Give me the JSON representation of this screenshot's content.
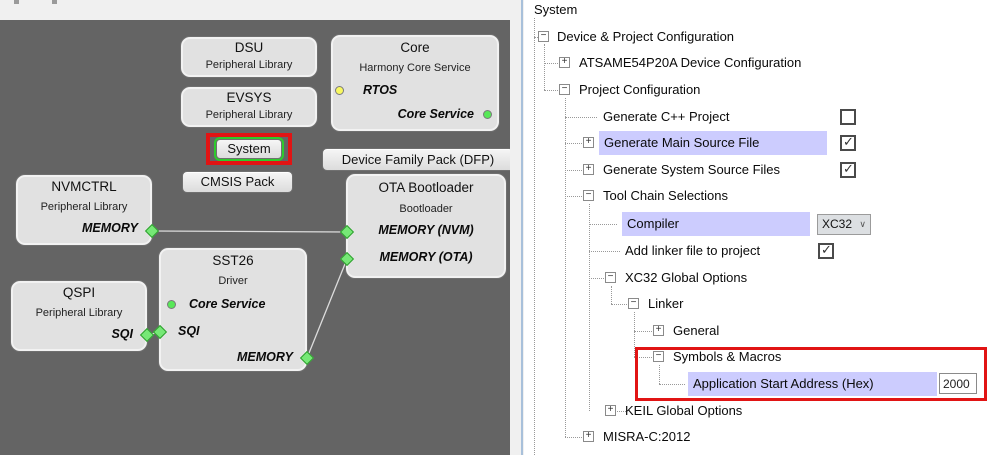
{
  "colors": {
    "annotation_red": "#e11414",
    "selected_green_border": "#2dcb2d",
    "row_highlight": "#ccccfe",
    "canvas_bg": "#646464",
    "diamond_green": "#76e876",
    "status_yellow": "#f8f860",
    "status_green": "#58e858"
  },
  "canvas": {
    "blocks": {
      "dsu": {
        "title": "DSU",
        "subtitle": "Peripheral Library"
      },
      "evsys": {
        "title": "EVSYS",
        "subtitle": "Peripheral Library"
      },
      "core": {
        "title": "Core",
        "subtitle": "Harmony Core Service",
        "rtos": "RTOS",
        "core_service": "Core Service"
      },
      "nvmctrl": {
        "title": "NVMCTRL",
        "subtitle": "Peripheral Library",
        "memory": "MEMORY"
      },
      "ota": {
        "title": "OTA Bootloader",
        "subtitle": "Bootloader",
        "mem_nvm": "MEMORY (NVM)",
        "mem_ota": "MEMORY (OTA)"
      },
      "sst26": {
        "title": "SST26",
        "subtitle": "Driver",
        "core_service": "Core Service",
        "sqi": "SQI",
        "memory": "MEMORY"
      },
      "qspi": {
        "title": "QSPI",
        "subtitle": "Peripheral Library",
        "sqi": "SQI"
      }
    },
    "buttons": {
      "system": "System",
      "dfp": "Device Family Pack (DFP)",
      "cmsis": "CMSIS Pack"
    }
  },
  "tree": {
    "rows": [
      {
        "label": "System"
      },
      {
        "label": "Device & Project Configuration"
      },
      {
        "label": "ATSAME54P20A Device Configuration"
      },
      {
        "label": "Project Configuration"
      },
      {
        "label": "Generate C++ Project",
        "checked": false
      },
      {
        "label": "Generate Main Source File",
        "checked": true,
        "highlighted": true
      },
      {
        "label": "Generate System Source Files",
        "checked": true
      },
      {
        "label": "Tool Chain Selections"
      },
      {
        "label": "Compiler",
        "highlighted": true,
        "value": "XC32"
      },
      {
        "label": "Add linker file to project",
        "checked": true
      },
      {
        "label": "XC32 Global Options"
      },
      {
        "label": "Linker"
      },
      {
        "label": "General"
      },
      {
        "label": "Symbols & Macros"
      },
      {
        "label": "Application Start Address (Hex)",
        "highlighted": true,
        "value": "2000"
      },
      {
        "label": "KEIL Global Options"
      },
      {
        "label": "MISRA-C:2012"
      }
    ],
    "compiler_value": "XC32",
    "app_start_value": "2000"
  }
}
